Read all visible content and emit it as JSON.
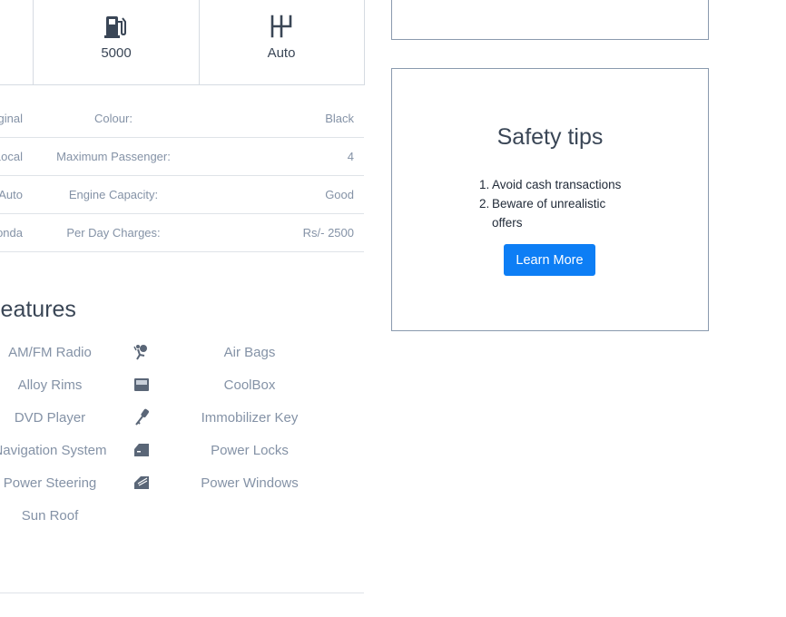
{
  "stats": [
    {
      "icon": "fuel-pump-icon",
      "value": "5000"
    },
    {
      "icon": "gear-shift-icon",
      "value": "Auto"
    }
  ],
  "specs": [
    {
      "prev": "iginal",
      "label": "Colour:",
      "value": "Black"
    },
    {
      "prev": "Local",
      "label": "Maximum Passenger:",
      "value": "4"
    },
    {
      "prev": "Auto",
      "label": "Engine Capacity:",
      "value": "Good"
    },
    {
      "prev": "onda",
      "label": "Per Day Charges:",
      "value": "Rs/- 2500"
    }
  ],
  "features": {
    "title": "r Features",
    "left": [
      "AM/FM Radio",
      "Alloy Rims",
      "DVD Player",
      "Navigation System",
      "Power Steering",
      "Sun Roof"
    ],
    "right": [
      "Air Bags",
      "CoolBox",
      "Immobilizer Key",
      "Power Locks",
      "Power Windows"
    ],
    "right_icons": [
      "airbag-icon",
      "coolbox-icon",
      "key-icon",
      "door-lock-icon",
      "power-window-icon"
    ]
  },
  "safety": {
    "title": "Safety tips",
    "tips": [
      "Avoid cash transactions",
      "Beware of unrealistic offers"
    ],
    "tip_numbers": [
      "1.",
      "2."
    ],
    "button_label": "Learn More"
  },
  "colors": {
    "accent": "#0d7ef5",
    "muted_text": "#8492a6",
    "heading": "#3a4656",
    "border": "#8a9aae"
  }
}
